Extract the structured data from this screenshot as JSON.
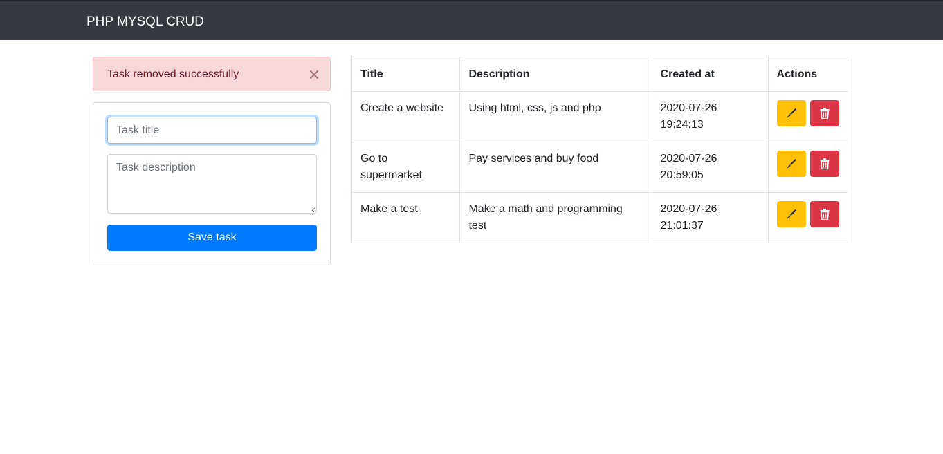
{
  "navbar": {
    "brand": "PHP MYSQL CRUD"
  },
  "alert": {
    "message": "Task removed successfully",
    "close_glyph": "×"
  },
  "form": {
    "title_placeholder": "Task title",
    "description_placeholder": "Task description",
    "save_label": "Save task"
  },
  "table": {
    "headers": [
      "Title",
      "Description",
      "Created at",
      "Actions"
    ],
    "rows": [
      {
        "title": "Create a website",
        "description": "Using html, css, js and php",
        "created_at": "2020-07-26 19:24:13"
      },
      {
        "title": "Go to supermarket",
        "description": "Pay services and buy food",
        "created_at": "2020-07-26 20:59:05"
      },
      {
        "title": "Make a test",
        "description": "Make a math and programming test",
        "created_at": "2020-07-26 21:01:37"
      }
    ]
  },
  "icons": {
    "edit": "marker-icon",
    "delete": "trash-icon",
    "close": "close-icon"
  },
  "colors": {
    "navbar": "#343a40",
    "alert_bg": "#f8d7da",
    "alert_text": "#721c24",
    "primary": "#007bff",
    "warning": "#ffc107",
    "danger": "#dc3545"
  }
}
